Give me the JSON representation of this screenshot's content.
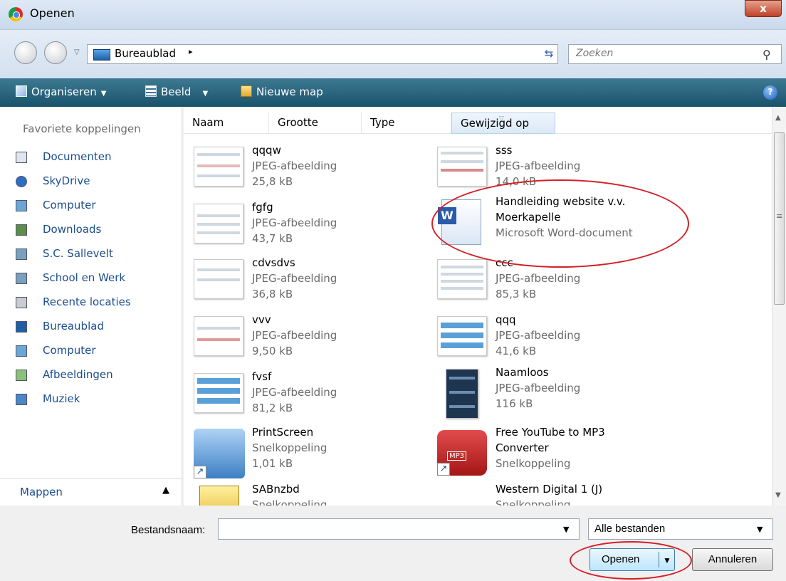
{
  "window": {
    "title": "Openen",
    "close_label": "x"
  },
  "address": {
    "location": "Bureaublad",
    "separator": "▸"
  },
  "search": {
    "placeholder": "Zoeken"
  },
  "toolbar": {
    "organize": "Organiseren",
    "view": "Beeld",
    "new_folder": "Nieuwe map",
    "help": "?"
  },
  "sidebar": {
    "favorites_header": "Favoriete koppelingen",
    "items": [
      {
        "label": "Documenten",
        "icon": "documents-icon"
      },
      {
        "label": "SkyDrive",
        "icon": "skydrive-icon"
      },
      {
        "label": "Computer",
        "icon": "computer-icon"
      },
      {
        "label": "Downloads",
        "icon": "downloads-icon"
      },
      {
        "label": "S.C. Sallevelt",
        "icon": "library-icon"
      },
      {
        "label": "School en Werk",
        "icon": "library-icon"
      },
      {
        "label": "Recente locaties",
        "icon": "recent-locations-icon"
      },
      {
        "label": "Bureaublad",
        "icon": "desktop-icon"
      },
      {
        "label": "Computer",
        "icon": "computer-icon"
      },
      {
        "label": "Afbeeldingen",
        "icon": "pictures-icon"
      },
      {
        "label": "Muziek",
        "icon": "music-icon"
      }
    ],
    "folders_label": "Mappen"
  },
  "columns": [
    "Naam",
    "Grootte",
    "Type",
    "Gewijzigd op"
  ],
  "files": [
    {
      "name": "qqqw",
      "type": "JPEG-afbeelding",
      "size": "25,8 kB"
    },
    {
      "name": "sss",
      "type": "JPEG-afbeelding",
      "size": "14,0 kB"
    },
    {
      "name": "fgfg",
      "type": "JPEG-afbeelding",
      "size": "43,7 kB"
    },
    {
      "name": "Handleiding website v.v.",
      "name2": "Moerkapelle",
      "type": "Microsoft Word-document"
    },
    {
      "name": "cdvsdvs",
      "type": "JPEG-afbeelding",
      "size": "36,8 kB"
    },
    {
      "name": "ccc",
      "type": "JPEG-afbeelding",
      "size": "85,3 kB"
    },
    {
      "name": "vvv",
      "type": "JPEG-afbeelding",
      "size": "9,50 kB"
    },
    {
      "name": "qqq",
      "type": "JPEG-afbeelding",
      "size": "41,6 kB"
    },
    {
      "name": "fvsf",
      "type": "JPEG-afbeelding",
      "size": "81,2 kB"
    },
    {
      "name": "Naamloos",
      "type": "JPEG-afbeelding",
      "size": "116 kB"
    },
    {
      "name": "PrintScreen",
      "type": "Snelkoppeling",
      "size": "1,01 kB"
    },
    {
      "name": "Free YouTube to MP3",
      "name2": "Converter",
      "type": "Snelkoppeling",
      "badge": "MP3"
    },
    {
      "name": "SABnzbd",
      "type": "Snelkoppeling"
    },
    {
      "name": "Western Digital 1  (J)",
      "type": "Snelkoppeling"
    }
  ],
  "bottom": {
    "filename_label": "Bestandsnaam:",
    "filename_value": "",
    "filter": "Alle bestanden",
    "open_button": "Openen",
    "cancel_button": "Annuleren"
  },
  "colors": {
    "annotation": "#d42026",
    "toolbar": "#1f5a73",
    "link": "#1b4e8f"
  }
}
